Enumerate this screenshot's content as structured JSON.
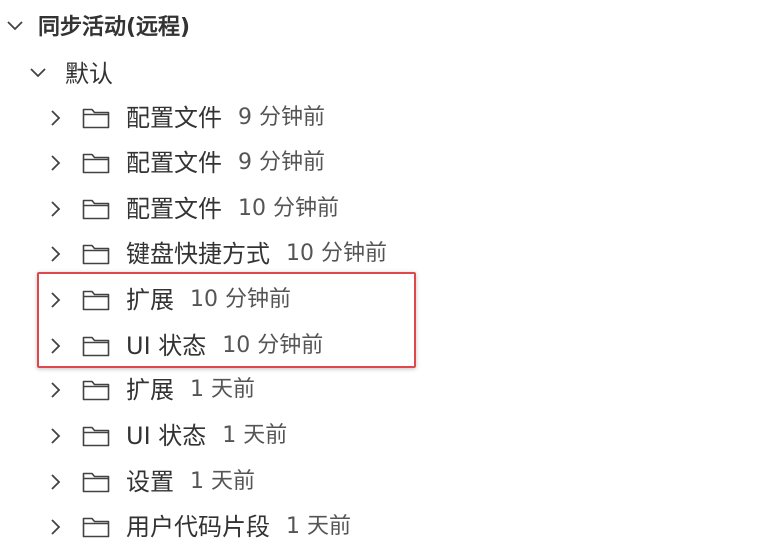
{
  "section": {
    "title": "同步活动(远程)",
    "expanded": true
  },
  "group": {
    "label": "默认",
    "expanded": true
  },
  "items": [
    {
      "label": "配置文件",
      "time": "9 分钟前"
    },
    {
      "label": "配置文件",
      "time": "9 分钟前"
    },
    {
      "label": "配置文件",
      "time": "10 分钟前"
    },
    {
      "label": "键盘快捷方式",
      "time": "10 分钟前"
    },
    {
      "label": "扩展",
      "time": "10 分钟前"
    },
    {
      "label": "UI 状态",
      "time": "10 分钟前"
    },
    {
      "label": "扩展",
      "time": "1 天前"
    },
    {
      "label": "UI 状态",
      "time": "1 天前"
    },
    {
      "label": "设置",
      "time": "1 天前"
    },
    {
      "label": "用户代码片段",
      "time": "1 天前"
    }
  ],
  "colors": {
    "highlight_border": "#e0474c",
    "text": "#333333",
    "icon": "#424242"
  },
  "icons": {
    "expanded": "chevron-down-icon",
    "collapsed": "chevron-right-icon",
    "folder": "folder-icon"
  }
}
